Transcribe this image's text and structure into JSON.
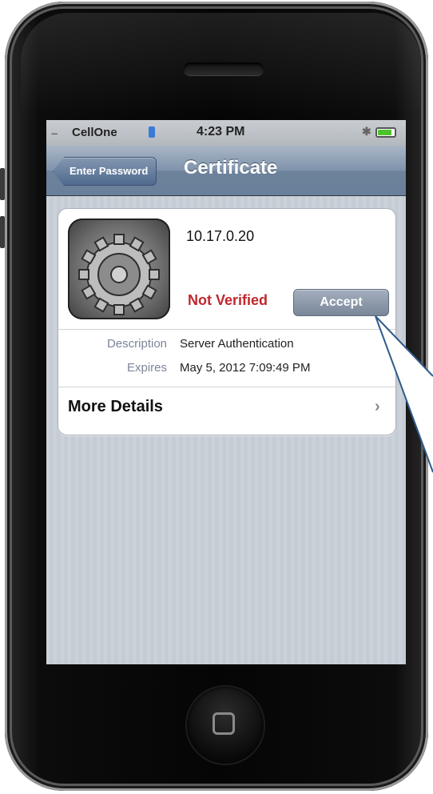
{
  "status_bar": {
    "signal": ".....",
    "carrier": "CellOne",
    "time": "4:23 PM",
    "bluetooth_icon": "bluetooth-icon",
    "battery_level": 0.85
  },
  "nav": {
    "back_label": "Enter Password",
    "title": "Certificate"
  },
  "certificate": {
    "host": "10.17.0.20",
    "status": "Not Verified",
    "status_color": "#c1272d",
    "accept_label": "Accept",
    "details": [
      {
        "label": "Description",
        "value": "Server Authentication"
      },
      {
        "label": "Expires",
        "value": "May 5, 2012 7:09:49 PM"
      }
    ],
    "more_label": "More Details",
    "more_chevron": "›"
  },
  "icons": {
    "certificate_icon": "settings-gear-icon",
    "home_button": "home-button-icon"
  }
}
